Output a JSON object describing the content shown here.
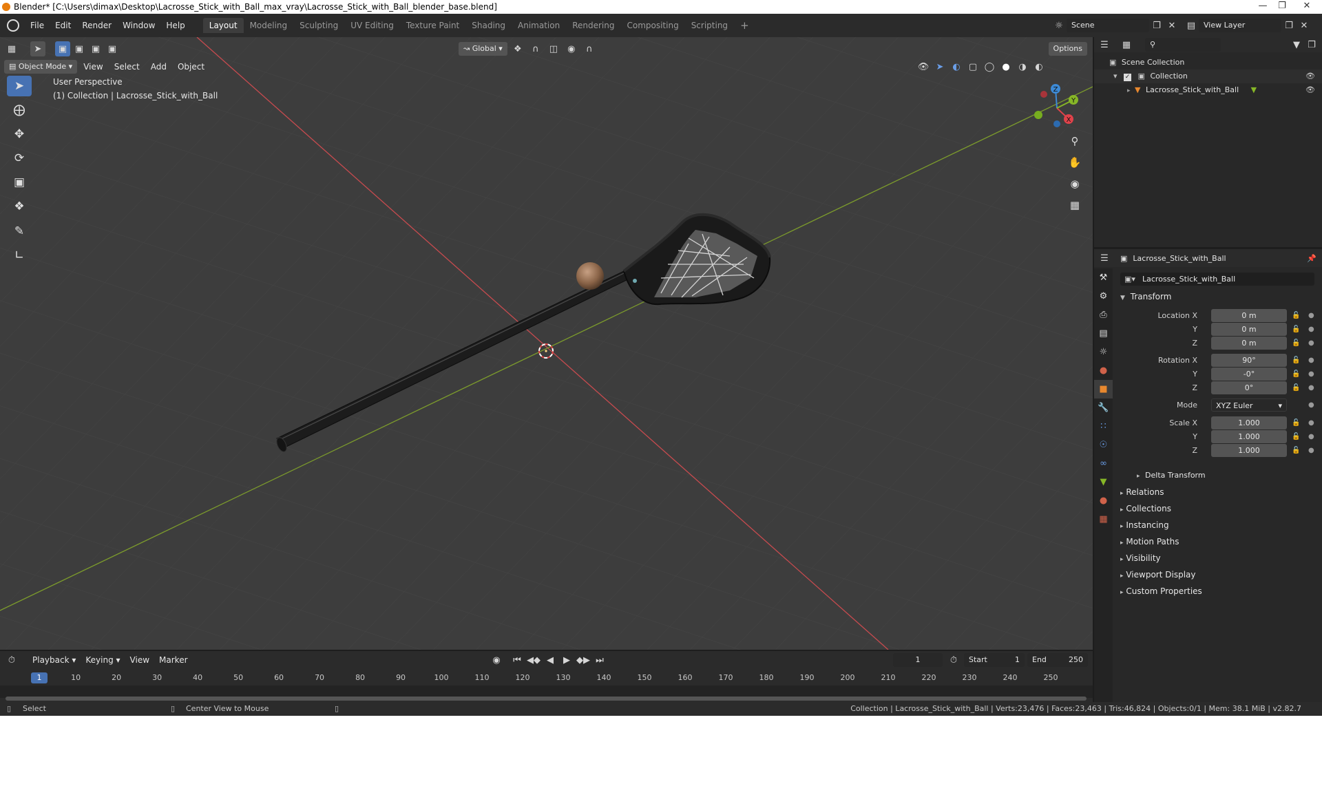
{
  "window": {
    "title": "Blender* [C:\\Users\\dimax\\Desktop\\Lacrosse_Stick_with_Ball_max_vray\\Lacrosse_Stick_with_Ball_blender_base.blend]"
  },
  "menu": {
    "items": [
      "File",
      "Edit",
      "Render",
      "Window",
      "Help"
    ]
  },
  "workspaces": [
    "Layout",
    "Modeling",
    "Sculpting",
    "UV Editing",
    "Texture Paint",
    "Shading",
    "Animation",
    "Rendering",
    "Compositing",
    "Scripting",
    "+"
  ],
  "scene": {
    "name": "Scene",
    "view_layer": "View Layer"
  },
  "viewport": {
    "mode": "Object Mode",
    "menus": [
      "View",
      "Select",
      "Add",
      "Object"
    ],
    "transform_orientation": "Global",
    "options_label": "Options",
    "overlay_line1": "User Perspective",
    "overlay_line2": "(1) Collection | Lacrosse_Stick_with_Ball",
    "gizmo_x": "X",
    "gizmo_y": "Y",
    "gizmo_z": "Z"
  },
  "outliner": {
    "root": "Scene Collection",
    "collection": "Collection",
    "object": "Lacrosse_Stick_with_Ball"
  },
  "properties": {
    "object_name": "Lacrosse_Stick_with_Ball",
    "object_field": "Lacrosse_Stick_with_Ball",
    "transform_header": "Transform",
    "location_label": "Location X",
    "y_label": "Y",
    "z_label": "Z",
    "location": {
      "x": "0 m",
      "y": "0 m",
      "z": "0 m"
    },
    "rotation_label": "Rotation X",
    "rotation": {
      "x": "90°",
      "y": "-0°",
      "z": "0°"
    },
    "mode_label": "Mode",
    "mode_value": "XYZ Euler",
    "scale_label": "Scale X",
    "scale": {
      "x": "1.000",
      "y": "1.000",
      "z": "1.000"
    },
    "delta_transform": "Delta Transform",
    "panels": [
      "Relations",
      "Collections",
      "Instancing",
      "Motion Paths",
      "Visibility",
      "Viewport Display",
      "Custom Properties"
    ]
  },
  "timeline": {
    "menus": [
      "Playback",
      "Keying",
      "View",
      "Marker"
    ],
    "current_frame": "1",
    "start_label": "Start",
    "start": "1",
    "end_label": "End",
    "end": "250",
    "ruler": [
      "1",
      "10",
      "20",
      "30",
      "40",
      "50",
      "60",
      "70",
      "80",
      "90",
      "100",
      "110",
      "120",
      "130",
      "140",
      "150",
      "160",
      "170",
      "180",
      "190",
      "200",
      "210",
      "220",
      "230",
      "240",
      "250"
    ]
  },
  "statusbar": {
    "select": "Select",
    "center": "Center View to Mouse",
    "stats": "Collection | Lacrosse_Stick_with_Ball | Verts:23,476 | Faces:23,463 | Tris:46,824 | Objects:0/1 | Mem: 38.1 MiB | v2.82.7"
  },
  "colors": {
    "accent": "#4772b3",
    "x_axis": "#e0424a",
    "y_axis": "#86b627",
    "z_axis": "#3d8ad6",
    "object_orange": "#e8882e"
  }
}
